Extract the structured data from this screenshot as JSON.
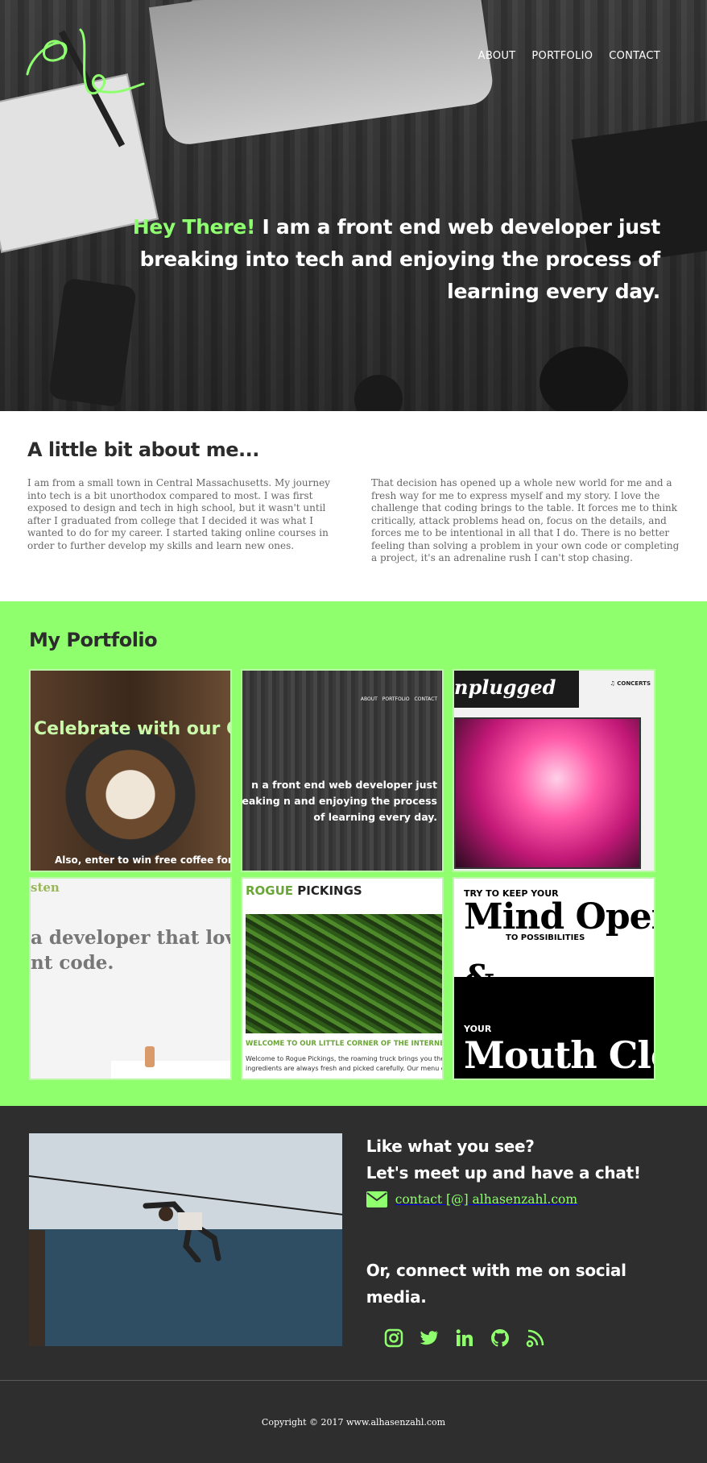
{
  "nav": {
    "items": [
      "ABOUT",
      "PORTFOLIO",
      "CONTACT"
    ]
  },
  "hero": {
    "highlight": "Hey There!",
    "text": " I am a front end web developer just breaking into tech and enjoying the process of learning every day",
    "end": ".",
    "accent": "#8eff6f"
  },
  "about": {
    "title": "A little bit about me...",
    "col1": "I am from a small town in Central Massachusetts.  My journey into tech is a bit unorthodox compared to most.  I was first exposed to design and tech in high school, but it wasn't until after I graduated from college that I decided it was what I wanted to do for my career.  I started taking online courses in order to further develop my skills and learn new ones.",
    "col2": "That decision has opened up a whole new world for me and a fresh way for me to express myself and my story.  I love the challenge that coding brings to the table.  It forces me to think critically, attack problems head on, focus on the details, and forces me to be intentional in all that I do.  There is no better feeling than solving a problem in your own code or completing a project, it's an adrenaline rush I can't stop chasing."
  },
  "portfolio": {
    "title": "My Portfolio",
    "background": "#8fff6e",
    "tiles": {
      "coffee": {
        "caption": "Celebrate with our C",
        "sub": "Also, enter to win free coffee for a"
      },
      "site": {
        "nav": [
          "ABOUT",
          "PORTFOLIO",
          "CONTACT"
        ],
        "text": "n a front end web developer just breaking n and enjoying the process of learning every day."
      },
      "unplugged": {
        "title": "nplugged",
        "concerts": "♫ CONCERTS"
      },
      "developer": {
        "top": "sten",
        "line1": "a developer that love",
        "line2": "nt code."
      },
      "rogue": {
        "brand_green": "ROGUE",
        "brand_black": " PICKINGS",
        "welcome": "WELCOME TO OUR LITTLE CORNER OF THE INTERNET",
        "body1": "Welcome to Rogue Pickings, the roaming truck brings you the",
        "body2": "ingredients are always fresh and picked carefully. Our menu c"
      },
      "mind": {
        "a": "TRY TO KEEP YOUR",
        "b": "Mind Open",
        "c": "TO POSSIBILITIES",
        "amp": "&",
        "d": "YOUR",
        "e": "Mouth Clo"
      }
    }
  },
  "contact": {
    "line1": "Like what you see?",
    "line2": "Let's meet up and have a chat!",
    "email": "contact [@] alhasenzahl.com",
    "social_heading": "Or, connect with me on social media.",
    "social_icons": [
      "instagram-icon",
      "twitter-icon",
      "linkedin-icon",
      "github-icon",
      "rss-icon"
    ],
    "accent": "#8fff6e"
  },
  "footer": {
    "copyright": "Copyright © 2017  www.alhasenzahl.com"
  }
}
